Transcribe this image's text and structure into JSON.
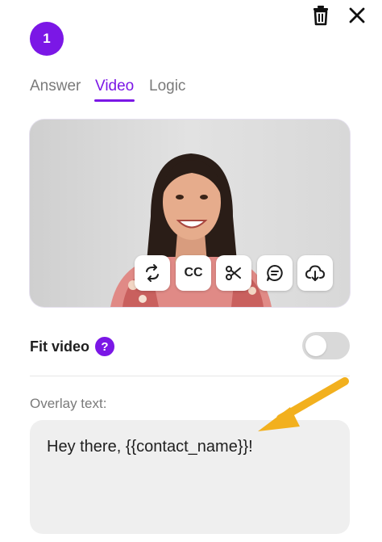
{
  "step": {
    "number": "1"
  },
  "header": {
    "icons": [
      "trash-icon",
      "close-icon"
    ]
  },
  "tabs": [
    {
      "label": "Answer",
      "active": false
    },
    {
      "label": "Video",
      "active": true
    },
    {
      "label": "Logic",
      "active": false
    }
  ],
  "video_tools": {
    "buttons": [
      {
        "icon": "replace-icon"
      },
      {
        "icon": "captions-icon",
        "label": "CC"
      },
      {
        "icon": "scissors-icon"
      },
      {
        "icon": "comment-icon"
      },
      {
        "icon": "download-icon"
      }
    ]
  },
  "fit_video": {
    "label": "Fit video",
    "help": "?",
    "enabled": false
  },
  "overlay": {
    "label": "Overlay text:",
    "value": "Hey there, {{contact_name}}!"
  },
  "colors": {
    "accent": "#7b17e6",
    "annotation_arrow": "#f2b01e",
    "toggle_off": "#d9d9d9",
    "input_bg": "#efefef"
  }
}
